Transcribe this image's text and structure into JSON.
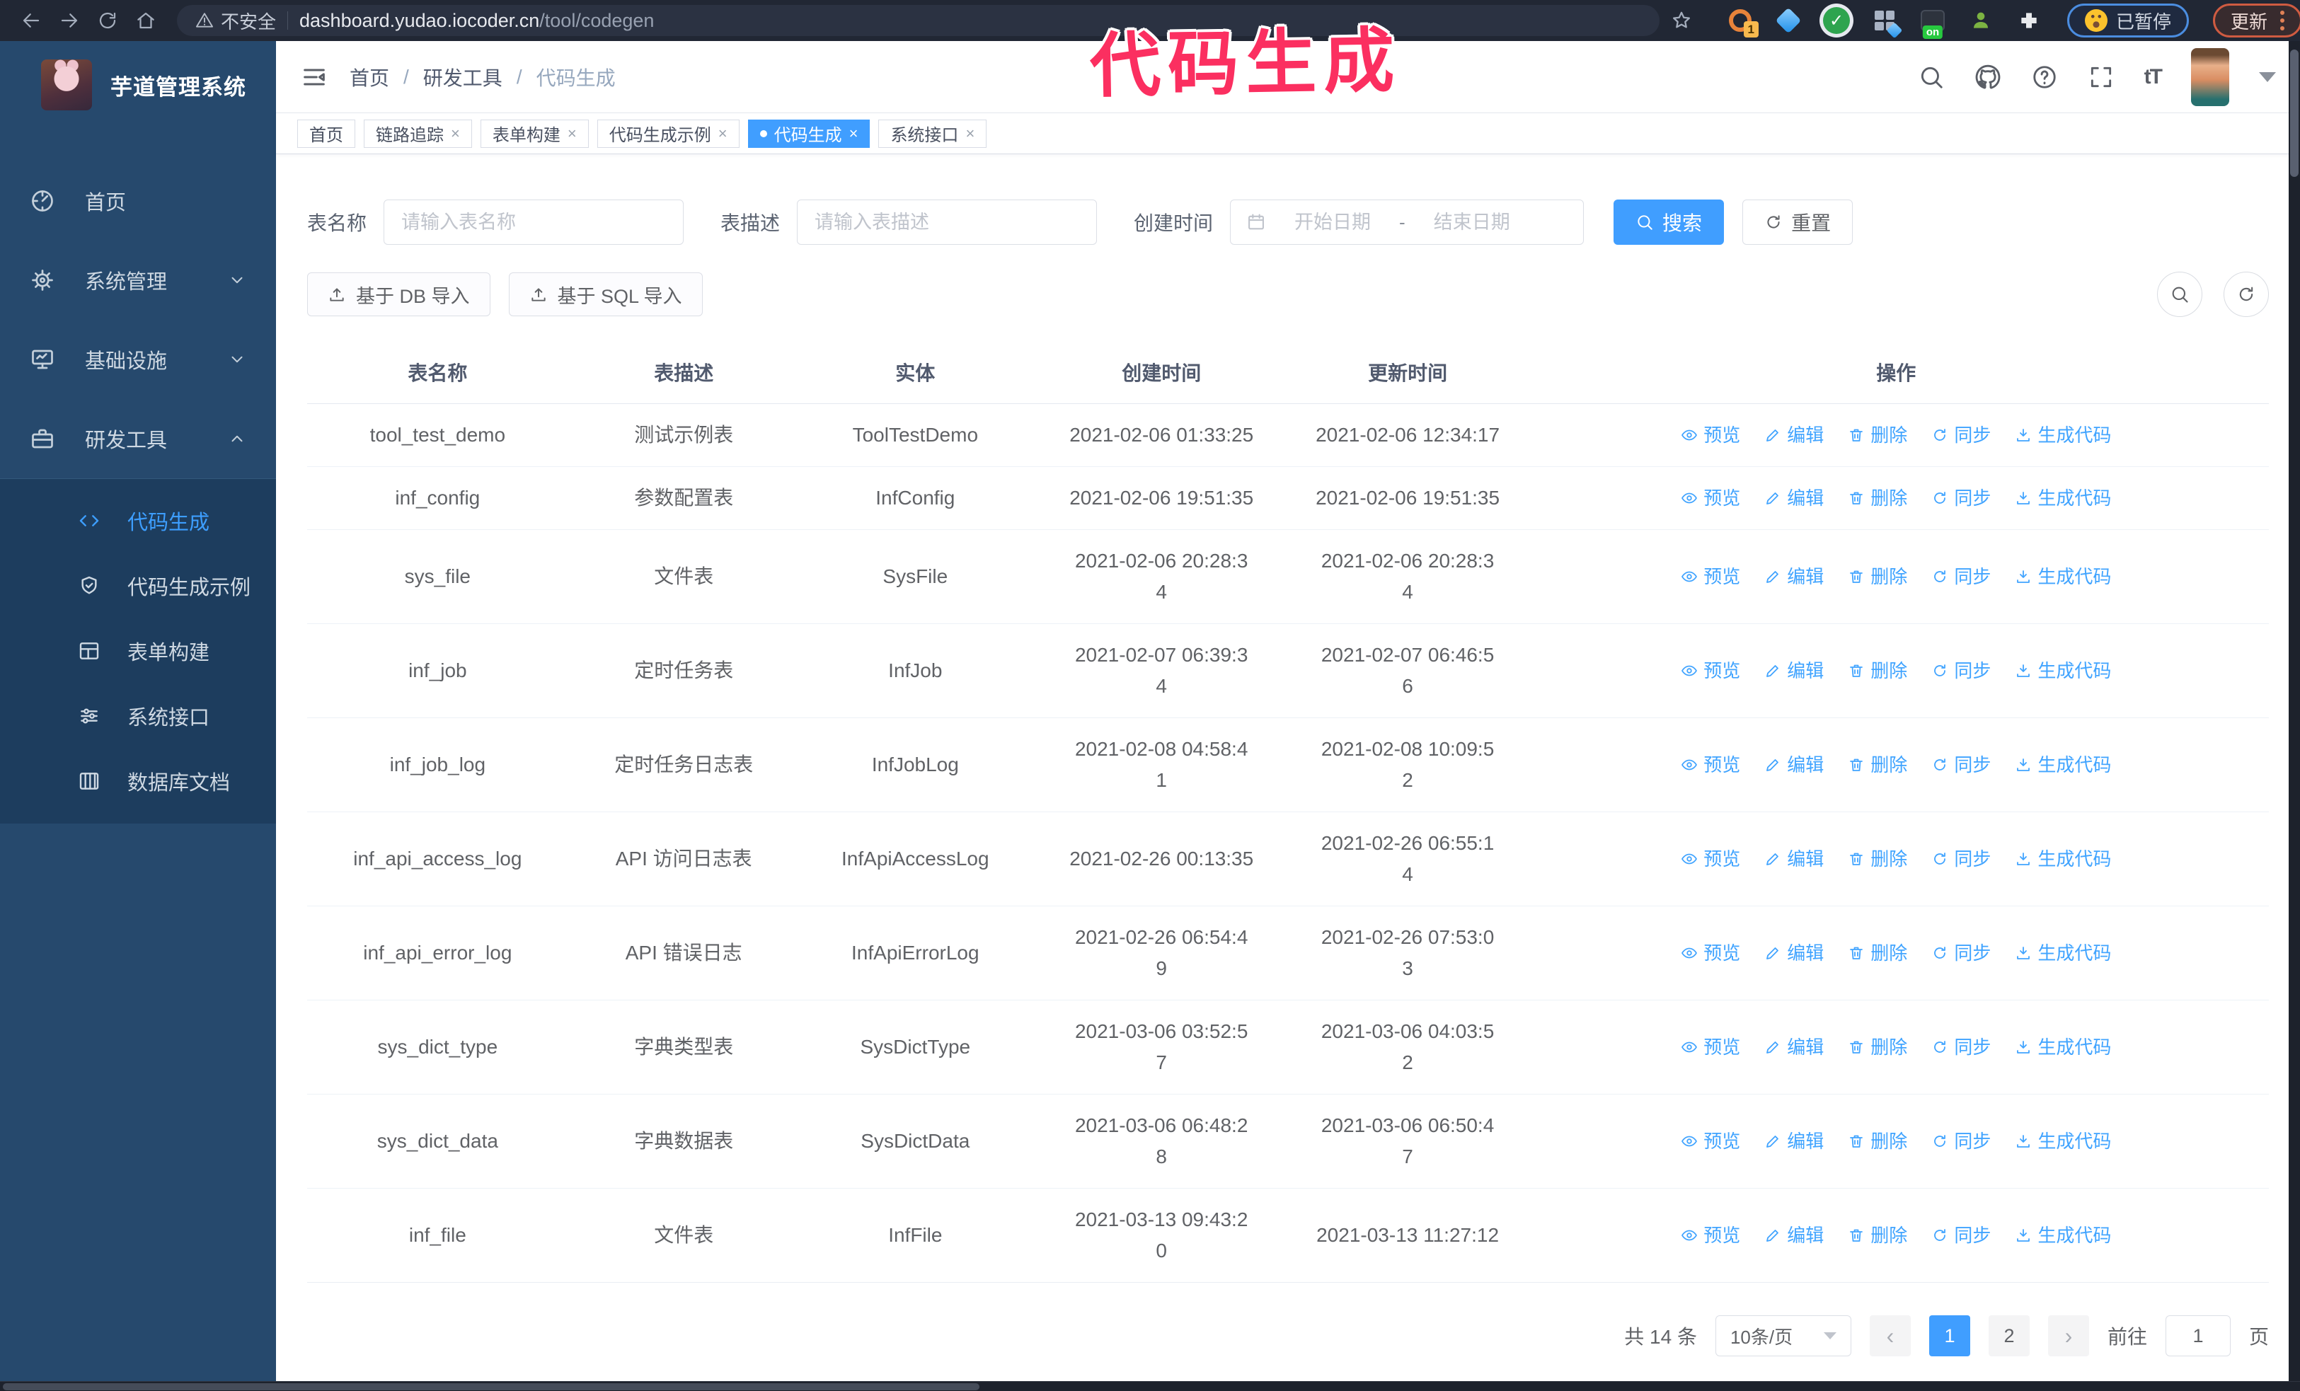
{
  "browser": {
    "security_warning": "不安全",
    "url_domain": "dashboard.yudao.iocoder.cn",
    "url_path": "/tool/codegen",
    "extension_badge": "1",
    "extension_on_badge": "on",
    "paused_badge": "已暂停",
    "update_button": "更新"
  },
  "watermark": "代码生成",
  "sidebar": {
    "title": "芋道管理系统",
    "items": [
      {
        "label": "首页"
      },
      {
        "label": "系统管理"
      },
      {
        "label": "基础设施"
      },
      {
        "label": "研发工具"
      }
    ],
    "submenu": [
      {
        "label": "代码生成"
      },
      {
        "label": "代码生成示例"
      },
      {
        "label": "表单构建"
      },
      {
        "label": "系统接口"
      },
      {
        "label": "数据库文档"
      }
    ]
  },
  "breadcrumb": {
    "items": [
      "首页",
      "研发工具",
      "代码生成"
    ],
    "separator": "/"
  },
  "tabs": [
    {
      "label": "首页"
    },
    {
      "label": "链路追踪"
    },
    {
      "label": "表单构建"
    },
    {
      "label": "代码生成示例"
    },
    {
      "label": "代码生成"
    },
    {
      "label": "系统接口"
    }
  ],
  "search": {
    "name_label": "表名称",
    "name_placeholder": "请输入表名称",
    "desc_label": "表描述",
    "desc_placeholder": "请输入表描述",
    "time_label": "创建时间",
    "start_placeholder": "开始日期",
    "range_separator": "-",
    "end_placeholder": "结束日期",
    "search_button": "搜索",
    "reset_button": "重置"
  },
  "toolbar": {
    "import_db": "基于 DB 导入",
    "import_sql": "基于 SQL 导入"
  },
  "table": {
    "columns": [
      "表名称",
      "表描述",
      "实体",
      "创建时间",
      "更新时间",
      "操作"
    ],
    "ops": [
      "预览",
      "编辑",
      "删除",
      "同步",
      "生成代码"
    ],
    "rows": [
      {
        "name": "tool_test_demo",
        "desc": "测试示例表",
        "entity": "ToolTestDemo",
        "created": "2021-02-06 01:33:25",
        "updated": "2021-02-06 12:34:17"
      },
      {
        "name": "inf_config",
        "desc": "参数配置表",
        "entity": "InfConfig",
        "created": "2021-02-06 19:51:35",
        "updated": "2021-02-06 19:51:35"
      },
      {
        "name": "sys_file",
        "desc": "文件表",
        "entity": "SysFile",
        "created": "2021-02-06 20:28:3\n4",
        "updated": "2021-02-06 20:28:3\n4"
      },
      {
        "name": "inf_job",
        "desc": "定时任务表",
        "entity": "InfJob",
        "created": "2021-02-07 06:39:3\n4",
        "updated": "2021-02-07 06:46:5\n6"
      },
      {
        "name": "inf_job_log",
        "desc": "定时任务日志表",
        "entity": "InfJobLog",
        "created": "2021-02-08 04:58:4\n1",
        "updated": "2021-02-08 10:09:5\n2"
      },
      {
        "name": "inf_api_access_log",
        "desc": "API 访问日志表",
        "entity": "InfApiAccessLog",
        "created": "2021-02-26 00:13:35",
        "updated": "2021-02-26 06:55:1\n4"
      },
      {
        "name": "inf_api_error_log",
        "desc": "API 错误日志",
        "entity": "InfApiErrorLog",
        "created": "2021-02-26 06:54:4\n9",
        "updated": "2021-02-26 07:53:0\n3"
      },
      {
        "name": "sys_dict_type",
        "desc": "字典类型表",
        "entity": "SysDictType",
        "created": "2021-03-06 03:52:5\n7",
        "updated": "2021-03-06 04:03:5\n2"
      },
      {
        "name": "sys_dict_data",
        "desc": "字典数据表",
        "entity": "SysDictData",
        "created": "2021-03-06 06:48:2\n8",
        "updated": "2021-03-06 06:50:4\n7"
      },
      {
        "name": "inf_file",
        "desc": "文件表",
        "entity": "InfFile",
        "created": "2021-03-13 09:43:2\n0",
        "updated": "2021-03-13 11:27:12"
      }
    ]
  },
  "pagination": {
    "total": "共 14 条",
    "page_size": "10条/页",
    "pages": [
      "1",
      "2"
    ],
    "goto_label": "前往",
    "goto_value": "1",
    "goto_suffix": "页"
  }
}
